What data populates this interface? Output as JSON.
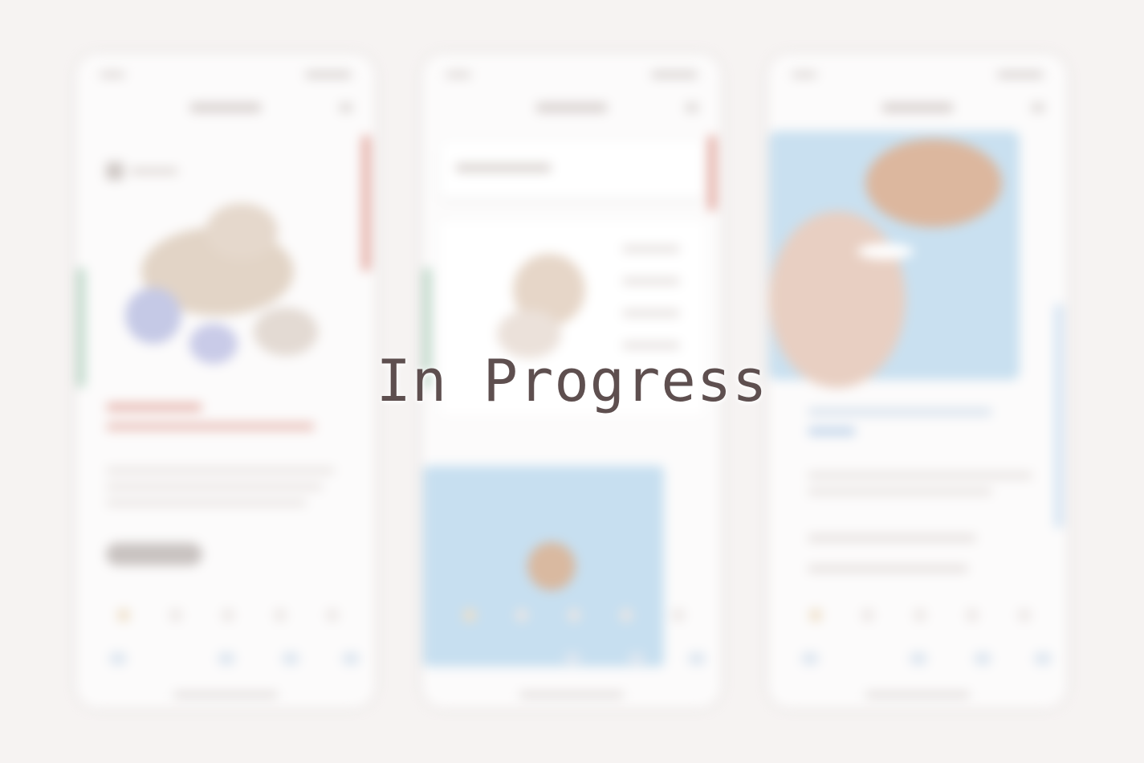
{
  "overlay": {
    "status_text": "In Progress"
  },
  "colors": {
    "background": "#f6f3f2",
    "overlay_text": "#5e4f4f",
    "accent_red": "#e6b5ad",
    "accent_blue": "#c9e0f0",
    "accent_green": "#b9d6c6"
  },
  "mockups": [
    {
      "name": "screen-1"
    },
    {
      "name": "screen-2"
    },
    {
      "name": "screen-3"
    }
  ]
}
